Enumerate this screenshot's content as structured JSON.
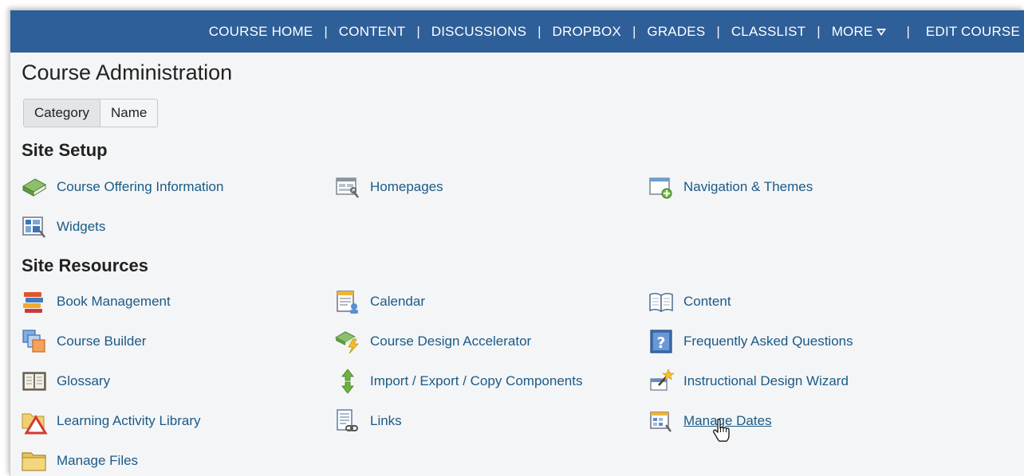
{
  "nav": {
    "items": [
      "COURSE HOME",
      "CONTENT",
      "DISCUSSIONS",
      "DROPBOX",
      "GRADES",
      "CLASSLIST",
      "MORE",
      "EDIT COURSE"
    ],
    "separator": "|",
    "background": "#2e5f98"
  },
  "page": {
    "title": "Course Administration"
  },
  "toggle": {
    "category": "Category",
    "name": "Name",
    "selected": "Category"
  },
  "sections": {
    "setup": "Site Setup",
    "resources": "Site Resources"
  },
  "tools": {
    "course_offering": {
      "label": "Course Offering Information",
      "icon": "book-icon"
    },
    "homepages": {
      "label": "Homepages",
      "icon": "homepage-icon"
    },
    "navigation": {
      "label": "Navigation & Themes",
      "icon": "navigation-icon"
    },
    "widgets": {
      "label": "Widgets",
      "icon": "widgets-icon"
    },
    "book_mgmt": {
      "label": "Book Management",
      "icon": "books-stack-icon"
    },
    "calendar": {
      "label": "Calendar",
      "icon": "calendar-icon"
    },
    "content": {
      "label": "Content",
      "icon": "open-book-icon"
    },
    "course_builder": {
      "label": "Course Builder",
      "icon": "layers-icon"
    },
    "design_accel": {
      "label": "Course Design Accelerator",
      "icon": "lightning-book-icon"
    },
    "faq": {
      "label": "Frequently Asked Questions",
      "icon": "question-icon"
    },
    "glossary": {
      "label": "Glossary",
      "icon": "glossary-icon"
    },
    "import_export": {
      "label": "Import / Export / Copy Components",
      "icon": "arrows-icon"
    },
    "design_wizard": {
      "label": "Instructional Design Wizard",
      "icon": "wizard-icon"
    },
    "activity_lib": {
      "label": "Learning Activity Library",
      "icon": "folder-triangle-icon"
    },
    "links": {
      "label": "Links",
      "icon": "links-icon"
    },
    "manage_dates": {
      "label": "Manage Dates",
      "icon": "dates-icon"
    },
    "manage_files": {
      "label": "Manage Files",
      "icon": "folder-icon"
    }
  },
  "colors": {
    "link": "#1a5a86",
    "background": "#f4f5f7"
  }
}
